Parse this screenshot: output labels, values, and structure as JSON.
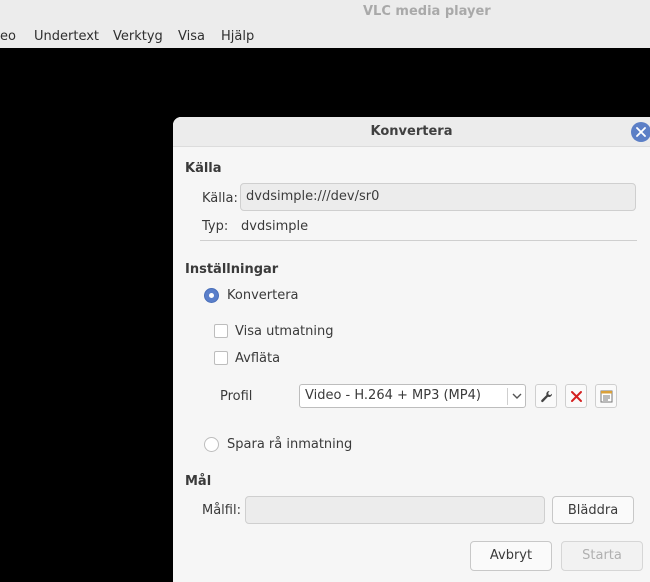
{
  "window": {
    "title": "VLC media player"
  },
  "menubar": {
    "items": [
      "eo",
      "Undertext",
      "Verktyg",
      "Visa",
      "Hjälp"
    ]
  },
  "dialog": {
    "title": "Konvertera",
    "source": {
      "section_title": "Källa",
      "source_label": "Källa:",
      "source_value": "dvdsimple:///dev/sr0",
      "type_label": "Typ:",
      "type_value": "dvdsimple"
    },
    "settings": {
      "section_title": "Inställningar",
      "convert_label": "Konvertera",
      "convert_checked": true,
      "show_output_label": "Visa utmatning",
      "show_output_checked": false,
      "deinterlace_label": "Avfläta",
      "deinterlace_checked": false,
      "profile_label": "Profil",
      "profile_value": "Video - H.264 + MP3 (MP4)",
      "dump_raw_label": "Spara rå inmatning",
      "dump_raw_checked": false
    },
    "destination": {
      "section_title": "Mål",
      "file_label": "Målfil:",
      "file_value": "",
      "browse_label": "Bläddra"
    },
    "buttons": {
      "cancel": "Avbryt",
      "start": "Starta"
    }
  }
}
